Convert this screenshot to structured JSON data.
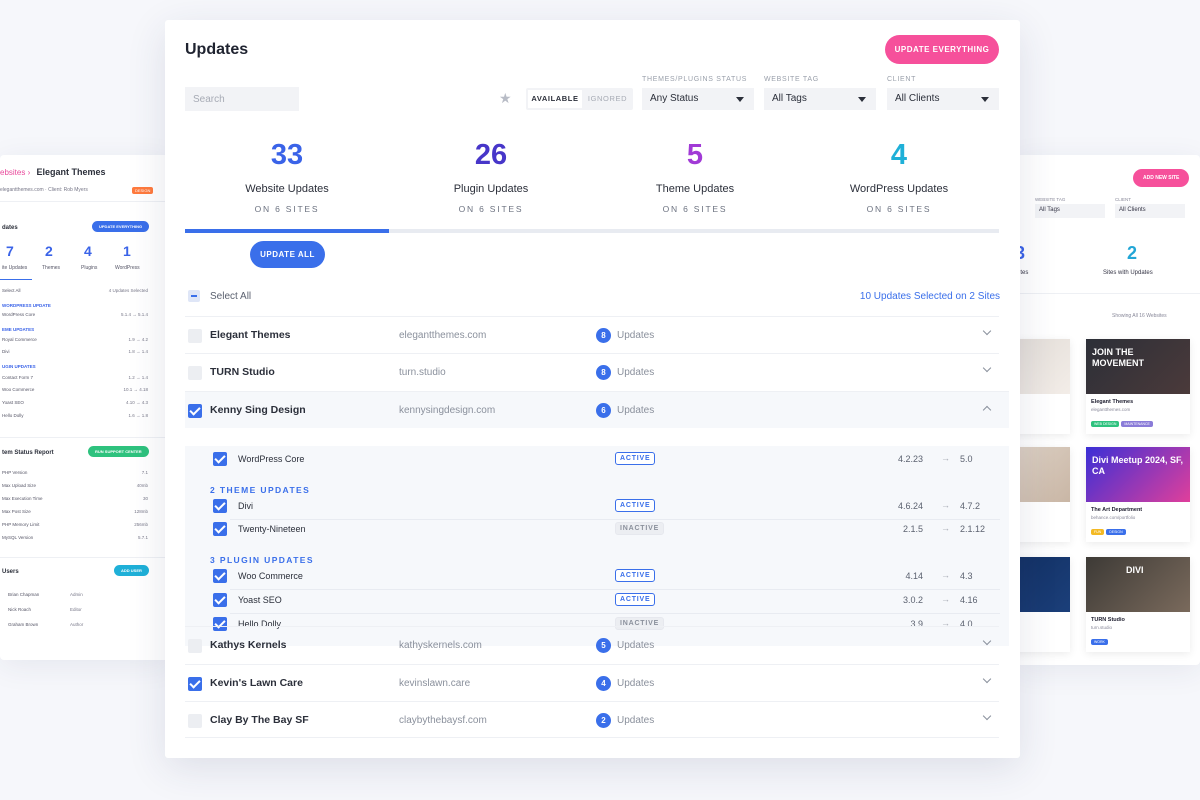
{
  "background_left": {
    "breadcrumb_root": "ebsites",
    "breadcrumb_site": "Elegant Themes",
    "meta": "elegantthemes.com  ·  Client: Rob Myers",
    "tag": "DESIGN",
    "section_title": "dates",
    "update_everything_label": "UPDATE EVERYTHING",
    "nums": [
      {
        "value": "7",
        "label": "ite Updates"
      },
      {
        "value": "2",
        "label": "Themes"
      },
      {
        "value": "4",
        "label": "Plugins"
      },
      {
        "value": "1",
        "label": "WordPress"
      }
    ],
    "select_all": "Select All",
    "selected": "4 Updates Selected",
    "lines": [
      {
        "text": "WORDPRESS UPDATE",
        "head": true
      },
      {
        "text": "WordPress Core",
        "val": "5.1.4 → 5.1.4"
      },
      {
        "text": "EME UPDATES",
        "head": true
      },
      {
        "text": "Royal Commerce",
        "val": "1.9 → 4.2"
      },
      {
        "text": "Divi",
        "val": "1.8 → 1.4"
      },
      {
        "text": "UGIN UPDATES",
        "head": true
      },
      {
        "text": "Contact Form 7",
        "val": "1.2 → 1.4"
      },
      {
        "text": "Woo Commerce",
        "val": "10.1 → 4.18"
      },
      {
        "text": "Yoast SEO",
        "val": "4.10 → 4.3"
      },
      {
        "text": "Hello Dolly",
        "val": "1.6 → 1.8"
      }
    ],
    "report_title": "tem Status Report",
    "report_btn": "RUN SUPPORT CENTER",
    "report_lines": [
      {
        "text": "PHP Version",
        "val": "7.1"
      },
      {
        "text": "Max Upload Size",
        "val": "40mb"
      },
      {
        "text": "Max Execution Time",
        "val": "30"
      },
      {
        "text": "Max Post Size",
        "val": "128mb"
      },
      {
        "text": "PHP Memory Limit",
        "val": "256mb"
      },
      {
        "text": "MySQL Version",
        "val": "5.7.1"
      }
    ],
    "users_title": "Users",
    "users_btn": "ADD USER",
    "users": [
      {
        "name": "Brian Chapman",
        "role": "Admin"
      },
      {
        "name": "Nick Roach",
        "role": "Editor"
      },
      {
        "name": "Graham Brown",
        "role": "Author"
      }
    ]
  },
  "background_right": {
    "add_site": "ADD NEW SITE",
    "tag_label": "WEBSITE TAG",
    "tag_value": "All Tags",
    "client_label": "CLIENT",
    "client_value": "All Clients",
    "num_left": "3",
    "num_left_label": "Sites",
    "num_right": "2",
    "num_right_label": "Sites with Updates",
    "showing": "Showing All 16 Websites",
    "cards": [
      {
        "name": "Elegant Themes",
        "url": "elegantthemes.com",
        "img_text": "JOIN THE MOVEMENT",
        "chips": [
          "WEB DESIGN",
          "MAINTENANCE"
        ]
      },
      {
        "name": "The Art Department",
        "url": "behance.com/portfolio",
        "img_text": "Divi Meetup 2024, SF, CA",
        "chips": [
          "FUN",
          "DESIGN"
        ]
      },
      {
        "name": "TURN Studio",
        "url": "turn.studio",
        "img_text": "DIVI",
        "chips": [
          "WORK"
        ]
      }
    ]
  },
  "header": {
    "title": "Updates",
    "update_everything": "UPDATE EVERYTHING"
  },
  "filters": {
    "search_placeholder": "Search",
    "star_icon": "star-icon",
    "toggle_available": "AVAILABLE",
    "toggle_ignored": "IGNORED",
    "status_label": "THEMES/PLUGINS STATUS",
    "status_value": "Any Status",
    "tag_label": "WEBSITE TAG",
    "tag_value": "All Tags",
    "client_label": "CLIENT",
    "client_value": "All Clients"
  },
  "stats": [
    {
      "value": "33",
      "label": "Website Updates",
      "sub": "ON 6 SITES",
      "color": "#3a63e8"
    },
    {
      "value": "26",
      "label": "Plugin Updates",
      "sub": "ON 6 SITES",
      "color": "#4736c9"
    },
    {
      "value": "5",
      "label": "Theme Updates",
      "sub": "ON 6 SITES",
      "color": "#a13ad6"
    },
    {
      "value": "4",
      "label": "WordPress Updates",
      "sub": "ON 6 SITES",
      "color": "#1fb0d8"
    }
  ],
  "progress": {
    "fraction": 0.25
  },
  "update_all": "UPDATE ALL",
  "selection": {
    "select_all": "Select All",
    "info": "10 Updates Selected on 2 Sites"
  },
  "sites": [
    {
      "name": "Elegant Themes",
      "url": "elegantthemes.com",
      "count": "8",
      "updates_label": "Updates",
      "checked": false
    },
    {
      "name": "TURN Studio",
      "url": "turn.studio",
      "count": "8",
      "updates_label": "Updates",
      "checked": false
    },
    {
      "name": "Kenny Sing Design",
      "url": "kennysingdesign.com",
      "count": "6",
      "updates_label": "Updates",
      "checked": true
    },
    {
      "name": "Kathys Kernels",
      "url": "kathyskernels.com",
      "count": "5",
      "updates_label": "Updates",
      "checked": false
    },
    {
      "name": "Kevin's Lawn Care",
      "url": "kevinslawn.care",
      "count": "4",
      "updates_label": "Updates",
      "checked": true
    },
    {
      "name": "Clay By The Bay SF",
      "url": "claybythebaysf.com",
      "count": "2",
      "updates_label": "Updates",
      "checked": false
    }
  ],
  "expanded": {
    "core": {
      "name": "WordPress Core",
      "status": "ACTIVE",
      "from": "4.2.23",
      "arrow": "→",
      "to": "5.0"
    },
    "theme_heading": "2 THEME UPDATES",
    "themes": [
      {
        "name": "Divi",
        "status": "ACTIVE",
        "from": "4.6.24",
        "arrow": "→",
        "to": "4.7.2"
      },
      {
        "name": "Twenty-Nineteen",
        "status": "INACTIVE",
        "from": "2.1.5",
        "arrow": "→",
        "to": "2.1.12"
      }
    ],
    "plugin_heading": "3 PLUGIN UPDATES",
    "plugins": [
      {
        "name": "Woo Commerce",
        "status": "ACTIVE",
        "from": "4.14",
        "arrow": "→",
        "to": "4.3"
      },
      {
        "name": "Yoast SEO",
        "status": "ACTIVE",
        "from": "3.0.2",
        "arrow": "→",
        "to": "4.16"
      },
      {
        "name": "Hello Dolly",
        "status": "INACTIVE",
        "from": "3.9",
        "arrow": "→",
        "to": "4.0"
      }
    ]
  }
}
